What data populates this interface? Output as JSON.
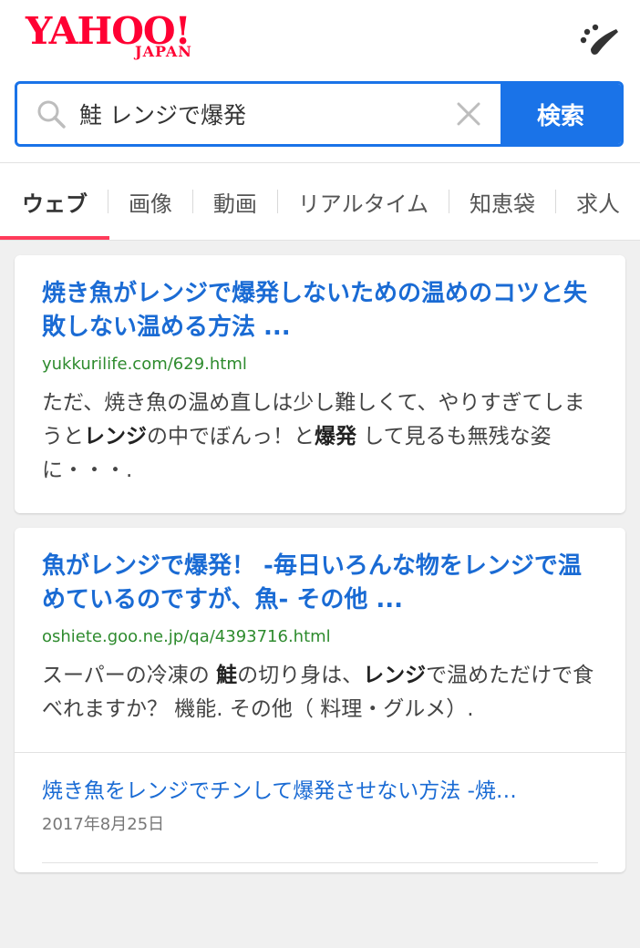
{
  "header": {
    "logo_main": "YAHOO!",
    "logo_sub": "JAPAN",
    "theme_icon": "palette-icon"
  },
  "search": {
    "query": "鮭 レンジで爆発",
    "button_label": "検索",
    "search_icon": "search-icon",
    "clear_icon": "close-icon"
  },
  "tabs": [
    {
      "label": "ウェブ",
      "active": true
    },
    {
      "label": "画像"
    },
    {
      "label": "動画"
    },
    {
      "label": "リアルタイム"
    },
    {
      "label": "知恵袋"
    },
    {
      "label": "求人"
    }
  ],
  "results": [
    {
      "title": "焼き魚がレンジで爆発しないための温めのコツと失敗しない温める方法 ...",
      "url": "yukkurilife.com/629.html",
      "snippet_parts": [
        {
          "t": "ただ、焼き魚の温め直しは少し難しくて、やりすぎてしまうと"
        },
        {
          "t": "レンジ",
          "b": true
        },
        {
          "t": "の中でぼんっ！と"
        },
        {
          "t": "爆発",
          "b": true
        },
        {
          "t": " して見るも無残な姿に・・・."
        }
      ]
    },
    {
      "title": "魚がレンジで爆発！ -毎日いろんな物をレンジで温めているのですが、魚- その他 ...",
      "url": "oshiete.goo.ne.jp/qa/4393716.html",
      "snippet_parts": [
        {
          "t": "スーパーの冷凍の "
        },
        {
          "t": "鮭",
          "b": true
        },
        {
          "t": "の切り身は、"
        },
        {
          "t": "レンジ",
          "b": true
        },
        {
          "t": "で温めただけで食べれますか？ 機能. その他（ 料理・グルメ）."
        }
      ],
      "sub": {
        "title": "焼き魚をレンジでチンして爆発させない方法 -焼…",
        "date": "2017年8月25日"
      }
    }
  ],
  "colors": {
    "brand_red": "#ff0033",
    "link_blue": "#1a6bd4",
    "url_green": "#2e8b2e",
    "accent_blue": "#1a73e8",
    "active_tab": "#ff3b5a"
  }
}
